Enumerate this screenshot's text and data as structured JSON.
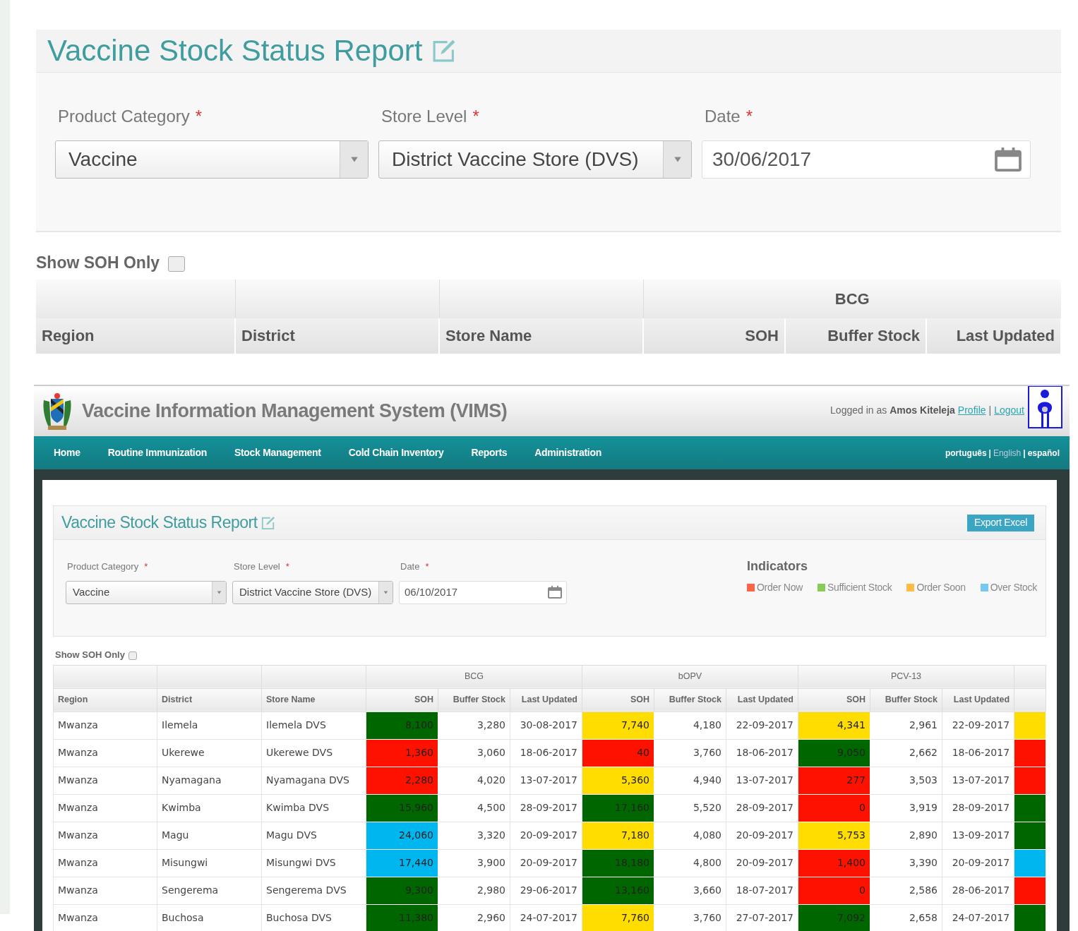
{
  "zoomed_view": {
    "title": "Vaccine Stock Status Report",
    "filters": [
      {
        "kind": "select",
        "label": "Product Category",
        "required_mark": "*",
        "value": "Vaccine"
      },
      {
        "kind": "select",
        "label": "Store Level",
        "required_mark": "*",
        "value": "District Vaccine Store (DVS)"
      },
      {
        "kind": "date",
        "label": "Date",
        "required_mark": "*",
        "value": "30/06/2017"
      }
    ],
    "show_soh_only": {
      "label": "Show SOH Only",
      "checked": false
    },
    "table": {
      "product_groups": [
        "BCG"
      ],
      "columns": [
        "Region",
        "District",
        "Store Name",
        "SOH",
        "Buffer Stock",
        "Last Updated"
      ]
    }
  },
  "app_header": {
    "title": "Vaccine Information Management System (VIMS)",
    "user_prefix": "Logged in as",
    "user_name": "Amos Kiteleja",
    "links": [
      "Profile",
      "Logout"
    ],
    "separator": "|"
  },
  "nav": {
    "items": [
      "Home",
      "Routine Immunization",
      "Stock Management",
      "Cold Chain Inventory",
      "Reports",
      "Administration"
    ],
    "languages": [
      {
        "label": "português",
        "selected": false
      },
      {
        "label": "English",
        "selected": true
      },
      {
        "label": "español",
        "selected": false
      }
    ],
    "separator": "|"
  },
  "report": {
    "title": "Vaccine Stock Status Report",
    "export_button": "Export Excel",
    "filters": [
      {
        "kind": "select",
        "label": "Product Category",
        "required_mark": "*",
        "value": "Vaccine"
      },
      {
        "kind": "select",
        "label": "Store Level",
        "required_mark": "*",
        "value": "District Vaccine Store (DVS)"
      },
      {
        "kind": "date",
        "label": "Date",
        "required_mark": "*",
        "value": "06/10/2017"
      }
    ],
    "indicators": {
      "title": "Indicators",
      "items": [
        {
          "label": "Order Now",
          "color": "#ff6347"
        },
        {
          "label": "Sufficient Stock",
          "color": "#88cc55"
        },
        {
          "label": "Order Soon",
          "color": "#ffbb44"
        },
        {
          "label": "Over Stock",
          "color": "#77c8f0"
        }
      ]
    },
    "show_soh_only": {
      "label": "Show SOH Only",
      "checked": false
    },
    "table": {
      "product_groups": [
        "BCG",
        "bOPV",
        "PCV-13"
      ],
      "columns": [
        "Region",
        "District",
        "Store Name",
        "SOH",
        "Buffer Stock",
        "Last Updated",
        "SOH",
        "Buffer Stock",
        "Last Updated",
        "SOH",
        "Buffer Stock",
        "Last Updated"
      ],
      "rows": [
        {
          "region": "Mwanza",
          "district": "Ilemela",
          "store": "Ilemela DVS",
          "products": [
            {
              "soh": "8,100",
              "color": "#006600",
              "buffer": "3,280",
              "updated": "30-08-2017"
            },
            {
              "soh": "7,740",
              "color": "#ffdd00",
              "buffer": "4,180",
              "updated": "22-09-2017"
            },
            {
              "soh": "4,341",
              "color": "#ffdd00",
              "buffer": "2,961",
              "updated": "22-09-2017"
            }
          ],
          "column_13": {
            "color": "#ffdd00"
          }
        },
        {
          "region": "Mwanza",
          "district": "Ukerewe",
          "store": "Ukerewe DVS",
          "products": [
            {
              "soh": "1,360",
              "color": "#ff1100",
              "buffer": "3,060",
              "updated": "18-06-2017"
            },
            {
              "soh": "40",
              "color": "#ff1100",
              "buffer": "3,760",
              "updated": "18-06-2017"
            },
            {
              "soh": "9,050",
              "color": "#006600",
              "buffer": "2,662",
              "updated": "18-06-2017"
            }
          ],
          "column_13": {
            "color": "#ff1100"
          }
        },
        {
          "region": "Mwanza",
          "district": "Nyamagana",
          "store": "Nyamagana DVS",
          "products": [
            {
              "soh": "2,280",
              "color": "#ff1100",
              "buffer": "4,020",
              "updated": "13-07-2017"
            },
            {
              "soh": "5,360",
              "color": "#ffdd00",
              "buffer": "4,940",
              "updated": "13-07-2017"
            },
            {
              "soh": "277",
              "color": "#ff1100",
              "buffer": "3,503",
              "updated": "13-07-2017"
            }
          ],
          "column_13": {
            "color": "#ff1100"
          }
        },
        {
          "region": "Mwanza",
          "district": "Kwimba",
          "store": "Kwimba DVS",
          "products": [
            {
              "soh": "15,960",
              "color": "#006600",
              "buffer": "4,500",
              "updated": "28-09-2017"
            },
            {
              "soh": "17,160",
              "color": "#006600",
              "buffer": "5,520",
              "updated": "28-09-2017"
            },
            {
              "soh": "0",
              "color": "#ff1100",
              "buffer": "3,919",
              "updated": "28-09-2017"
            }
          ],
          "column_13": {
            "color": "#006600"
          }
        },
        {
          "region": "Mwanza",
          "district": "Magu",
          "store": "Magu DVS",
          "products": [
            {
              "soh": "24,060",
              "color": "#00b6ef",
              "buffer": "3,320",
              "updated": "20-09-2017"
            },
            {
              "soh": "7,180",
              "color": "#ffdd00",
              "buffer": "4,080",
              "updated": "20-09-2017"
            },
            {
              "soh": "5,753",
              "color": "#ffdd00",
              "buffer": "2,890",
              "updated": "13-09-2017"
            }
          ],
          "column_13": {
            "color": "#006600"
          }
        },
        {
          "region": "Mwanza",
          "district": "Misungwi",
          "store": "Misungwi DVS",
          "products": [
            {
              "soh": "17,440",
              "color": "#00b6ef",
              "buffer": "3,900",
              "updated": "20-09-2017"
            },
            {
              "soh": "18,180",
              "color": "#006600",
              "buffer": "4,800",
              "updated": "20-09-2017"
            },
            {
              "soh": "1,400",
              "color": "#ff1100",
              "buffer": "3,390",
              "updated": "20-09-2017"
            }
          ],
          "column_13": {
            "color": "#00b6ef"
          }
        },
        {
          "region": "Mwanza",
          "district": "Sengerema",
          "store": "Sengerema DVS",
          "products": [
            {
              "soh": "9,300",
              "color": "#006600",
              "buffer": "2,980",
              "updated": "29-06-2017"
            },
            {
              "soh": "13,160",
              "color": "#006600",
              "buffer": "3,660",
              "updated": "18-07-2017"
            },
            {
              "soh": "0",
              "color": "#ff1100",
              "buffer": "2,586",
              "updated": "28-06-2017"
            }
          ],
          "column_13": {
            "color": "#ff1100"
          }
        },
        {
          "region": "Mwanza",
          "district": "Buchosa",
          "store": "Buchosa DVS",
          "products": [
            {
              "soh": "11,380",
              "color": "#006600",
              "buffer": "2,960",
              "updated": "24-07-2017"
            },
            {
              "soh": "7,760",
              "color": "#ffdd00",
              "buffer": "3,760",
              "updated": "27-07-2017"
            },
            {
              "soh": "7,092",
              "color": "#006600",
              "buffer": "2,658",
              "updated": "24-07-2017"
            }
          ],
          "column_13": {
            "color": "#006600"
          }
        }
      ]
    }
  }
}
